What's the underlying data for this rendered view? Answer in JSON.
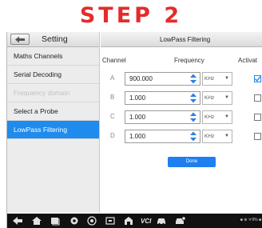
{
  "heading": "STEP 2",
  "left": {
    "title": "Setting",
    "items": [
      {
        "label": "Maths Channels",
        "state": "normal"
      },
      {
        "label": "Serial Decoding",
        "state": "normal"
      },
      {
        "label": "Frequency domain",
        "state": "disabled"
      },
      {
        "label": "Select a Probe",
        "state": "normal"
      },
      {
        "label": "LowPass Filtering",
        "state": "active"
      }
    ]
  },
  "right": {
    "title": "LowPass Filtering",
    "columns": {
      "channel": "Channel",
      "frequency": "Frequency",
      "activate": "Activat"
    },
    "rows": [
      {
        "letter": "A",
        "value": "900.000",
        "unit": "KHz",
        "checked": true
      },
      {
        "letter": "B",
        "value": "1.000",
        "unit": "KHz",
        "checked": false
      },
      {
        "letter": "C",
        "value": "1.000",
        "unit": "KHz",
        "checked": false
      },
      {
        "letter": "D",
        "value": "1.000",
        "unit": "KHz",
        "checked": false
      }
    ],
    "done_label": "Done"
  },
  "navbar": {
    "vci_label": "VCI",
    "status_text": "■ ⊕ ᯤ9% ■"
  },
  "colors": {
    "heading": "#e52b2b",
    "accent": "#1f8bec",
    "navbar": "#111111"
  }
}
